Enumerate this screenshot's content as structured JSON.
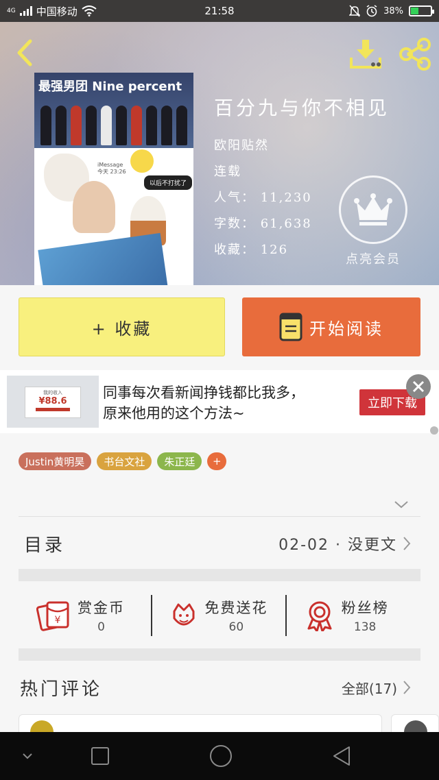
{
  "status_bar": {
    "network": "4G",
    "carrier": "中国移动",
    "time": "21:58",
    "battery": "38%",
    "battery_level": 0.38
  },
  "header": {
    "back_icon": "chevron-left-icon",
    "download_icon": "download-icon",
    "share_icon": "share-icon",
    "icon_color": "#f2e55a"
  },
  "cover": {
    "title_text": "最强男团 Nine percent",
    "imessage": "iMessage",
    "imessage_time": "今天 23:26",
    "bubble": "以后不打扰了"
  },
  "book": {
    "title": "百分九与你不相见",
    "author": "欧阳贴然",
    "status": "连载",
    "popularity_label": "人气：",
    "popularity": "11,230",
    "word_count_label": "字数：",
    "word_count": "61,638",
    "favorites_label": "收藏：",
    "favorites": "126"
  },
  "vip": {
    "label": "点亮会员",
    "icon": "crown-icon"
  },
  "actions": {
    "favorite_label": "+ 收藏",
    "read_label": "开始阅读",
    "favorite_color": "#f8f07e",
    "read_color": "#e86c3c"
  },
  "ad": {
    "thumb_caption": "我的收入",
    "thumb_amount": "¥88.6",
    "line1": "同事每次看新闻挣钱都比我多，",
    "line2": "原来他用的这个方法~",
    "button": "立即下载"
  },
  "tags": [
    {
      "label": "Justin黄明昊",
      "color": "#c9705c"
    },
    {
      "label": "书台文社",
      "color": "#d9a33f"
    },
    {
      "label": "朱正廷",
      "color": "#8cb64c"
    },
    {
      "label": "+",
      "color": "#e86c3c"
    }
  ],
  "toc": {
    "label": "目录",
    "latest": "02-02 · 没更文"
  },
  "stats": [
    {
      "title": "赏金币",
      "value": "0",
      "icon": "red-packet-icon"
    },
    {
      "title": "免费送花",
      "value": "60",
      "icon": "flower-icon"
    },
    {
      "title": "粉丝榜",
      "value": "138",
      "icon": "medal-icon"
    }
  ],
  "comments": {
    "label": "热门评论",
    "all_label": "全部(17)"
  }
}
